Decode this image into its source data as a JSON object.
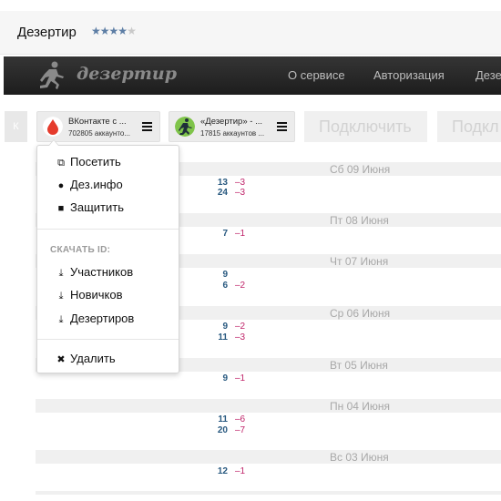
{
  "app": {
    "title": "Дезертир",
    "rating": 4,
    "rating_max": 5
  },
  "navbar": {
    "logo_text": "дезертир",
    "links": [
      "О сервисе",
      "Авторизация",
      "Дезе"
    ]
  },
  "accounts": [
    {
      "name": "ВКонтакте с ...",
      "count": "702805 аккаунто...",
      "icon": "vk-drop-avatar"
    },
    {
      "name": "«Дезертир» - ...",
      "count": "17815 аккаунтов ...",
      "icon": "dezertir-runner-avatar"
    }
  ],
  "connect_buttons": [
    "Подключить",
    "Подкл"
  ],
  "left_arrow": "К",
  "days": [
    {
      "label": "Сб 09 Июня",
      "stats": [
        {
          "a": "13",
          "b": "–3"
        },
        {
          "a": "24",
          "b": "–3"
        }
      ]
    },
    {
      "label": "Пт 08 Июня",
      "stats": [
        {
          "a": "7",
          "b": "–1"
        }
      ]
    },
    {
      "label": "Чт 07 Июня",
      "stats": [
        {
          "a": "9",
          "b": ""
        },
        {
          "a": "6",
          "b": "–2"
        }
      ]
    },
    {
      "label": "Ср 06 Июня",
      "stats": [
        {
          "a": "9",
          "b": "–2"
        },
        {
          "a": "11",
          "b": "–3"
        }
      ]
    },
    {
      "label": "Вт 05 Июня",
      "stats": [
        {
          "a": "9",
          "b": "–1"
        }
      ]
    },
    {
      "label": "Пн 04 Июня",
      "stats": [
        {
          "a": "11",
          "b": "–6"
        },
        {
          "a": "20",
          "b": "–7"
        }
      ]
    },
    {
      "label": "Вс 03 Июня",
      "stats": [
        {
          "a": "12",
          "b": "–1"
        }
      ]
    }
  ],
  "menu": {
    "visit": "Посетить",
    "info": "Дез.инфо",
    "protect": "Защитить",
    "download_header": "СКАЧАТЬ ID:",
    "members": "Участников",
    "newbies": "Новичков",
    "deserters": "Дезертиров",
    "delete": "Удалить"
  }
}
